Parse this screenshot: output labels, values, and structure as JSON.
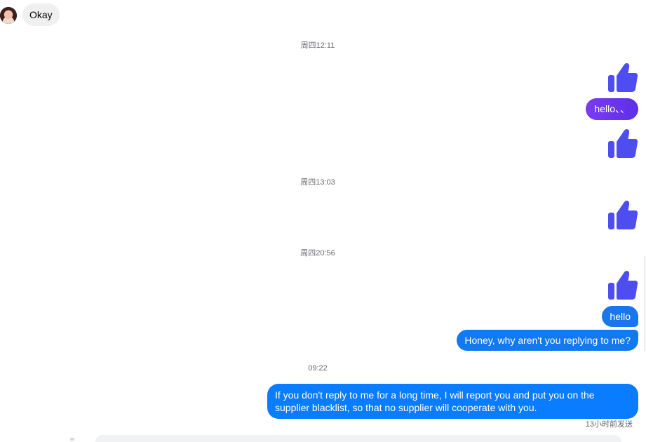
{
  "thread": {
    "incoming": {
      "text": "Okay"
    },
    "timestamps": {
      "t1": "周四12:11",
      "t2": "周四13:03",
      "t3": "周四20:56",
      "t4": "09:22"
    },
    "outgoing": {
      "m1": "hello、、",
      "m2": "hello",
      "m3": "Honey, why aren't you replying to me?",
      "m4": "If you don't reply to me for a long time, I will report you and put you on the supplier blacklist, so that no supplier will cooperate with you."
    },
    "sent_status": "13小时前发送"
  },
  "icons": {
    "like": "thumbs-up-icon",
    "avatar": "contact-avatar"
  },
  "colors": {
    "like": "#4e4ef0",
    "purple_bubble": "#6a35ee",
    "blue_bubble": "#0a7cff",
    "incoming_bubble": "#f0f0f0"
  }
}
